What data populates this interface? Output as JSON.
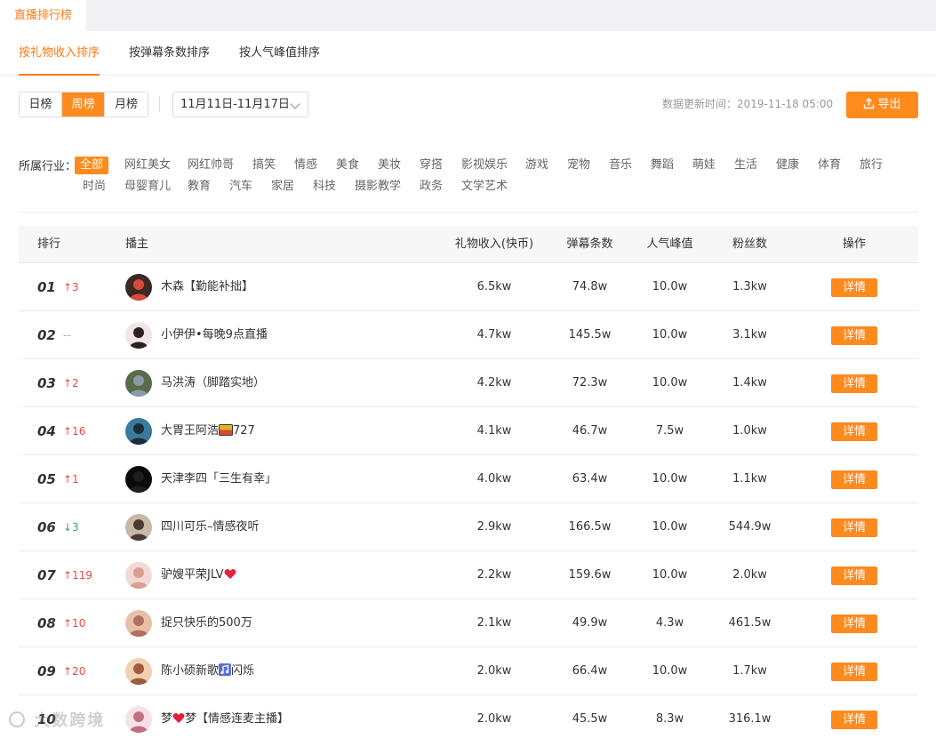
{
  "top_tab": "直播排行榜",
  "sort_tabs": [
    "按礼物收入排序",
    "按弹幕条数排序",
    "按人气峰值排序"
  ],
  "period": {
    "options": [
      "日榜",
      "周榜",
      "月榜"
    ],
    "selected": "周榜"
  },
  "date_range": "11月11日-11月17日",
  "update_time": "数据更新时间：2019-11-18 05:00",
  "export_label": "导出",
  "industry": {
    "label": "所属行业：",
    "tags": [
      "全部",
      "网红美女",
      "网红帅哥",
      "搞笑",
      "情感",
      "美食",
      "美妆",
      "穿搭",
      "影视娱乐",
      "游戏",
      "宠物",
      "音乐",
      "舞蹈",
      "萌娃",
      "生活",
      "健康",
      "体育",
      "旅行",
      "时尚",
      "母婴育儿",
      "教育",
      "汽车",
      "家居",
      "科技",
      "摄影教学",
      "政务",
      "文学艺术"
    ],
    "selected": "全部"
  },
  "table": {
    "headers": [
      "排行",
      "播主",
      "礼物收入(快币)",
      "弹幕条数",
      "人气峰值",
      "粉丝数",
      "操作"
    ],
    "detail_label": "详情",
    "rows": [
      {
        "rank": "01",
        "trend": "↑3",
        "dir": "up",
        "name": "木森【勤能补拙】",
        "gift": "6.5kw",
        "danmu": "74.8w",
        "peak": "10.0w",
        "fans": "1.3kw"
      },
      {
        "rank": "02",
        "trend": "--",
        "dir": "flat",
        "name": "小伊伊•每晚9点直播",
        "gift": "4.7kw",
        "danmu": "145.5w",
        "peak": "10.0w",
        "fans": "3.1kw"
      },
      {
        "rank": "03",
        "trend": "↑2",
        "dir": "up",
        "name": "马洪涛（脚踏实地）",
        "gift": "4.2kw",
        "danmu": "72.3w",
        "peak": "10.0w",
        "fans": "1.4kw"
      },
      {
        "rank": "04",
        "trend": "↑16",
        "dir": "up",
        "name": "大胃王阿浩",
        "name_suffix": "727",
        "name_icon": "flag",
        "gift": "4.1kw",
        "danmu": "46.7w",
        "peak": "7.5w",
        "fans": "1.0kw"
      },
      {
        "rank": "05",
        "trend": "↑1",
        "dir": "up",
        "name": "天津李四「三生有幸」",
        "gift": "4.0kw",
        "danmu": "63.4w",
        "peak": "10.0w",
        "fans": "1.1kw"
      },
      {
        "rank": "06",
        "trend": "↓3",
        "dir": "down",
        "name": "四川可乐–情感夜听",
        "gift": "2.9kw",
        "danmu": "166.5w",
        "peak": "10.0w",
        "fans": "544.9w"
      },
      {
        "rank": "07",
        "trend": "↑119",
        "dir": "up",
        "name": "驴嫂平荣JLV",
        "name_icon": "heart",
        "gift": "2.2kw",
        "danmu": "159.6w",
        "peak": "10.0w",
        "fans": "2.0kw"
      },
      {
        "rank": "08",
        "trend": "↑10",
        "dir": "up",
        "name": "捉只快乐的500万",
        "gift": "2.1kw",
        "danmu": "49.9w",
        "peak": "4.3w",
        "fans": "461.5w"
      },
      {
        "rank": "09",
        "trend": "↑20",
        "dir": "up",
        "name": "陈小硕新歌",
        "name_suffix": "闪烁",
        "name_icon": "music",
        "gift": "2.0kw",
        "danmu": "66.4w",
        "peak": "10.0w",
        "fans": "1.7kw"
      },
      {
        "rank": "10",
        "trend": "",
        "dir": "up",
        "name": "梦",
        "name_suffix": "梦【情感连麦主播】",
        "name_icon": "heart",
        "gift": "2.0kw",
        "danmu": "45.5w",
        "peak": "8.3w",
        "fans": "316.1w"
      }
    ]
  },
  "watermark": "大数跨境",
  "colors": {
    "accent": "#ff8a1e",
    "up": "#e94a4a",
    "down": "#35a85a"
  }
}
